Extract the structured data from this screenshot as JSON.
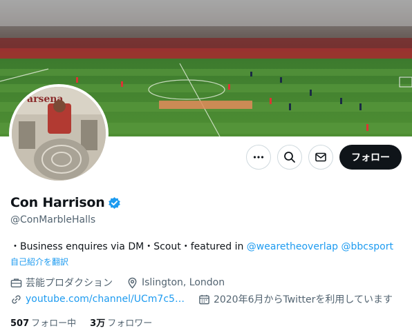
{
  "profile": {
    "name": "Con Harrison",
    "handle": "@ConMarbleHalls",
    "verified": true,
    "bio_text": "・Business enquires via DM・Scout・featured in ",
    "bio_mention_1": "@wearetheoverlap",
    "bio_mention_2": "@bbcsport",
    "translate_label": "自己紹介を翻訳",
    "category": "芸能プロダクション",
    "location": "Islington, London",
    "website": "youtube.com/channel/UCm7c5…",
    "joined": "2020年6月からTwitterを利用しています"
  },
  "actions": {
    "follow_label": "フォロー"
  },
  "stats": {
    "following_count": "507",
    "following_label": "フォロー中",
    "followers_count": "3万",
    "followers_label": "フォロワー"
  },
  "colors": {
    "accent": "#1d9bf0",
    "text": "#0f1419",
    "secondary": "#536471",
    "border": "#cfd9de"
  }
}
